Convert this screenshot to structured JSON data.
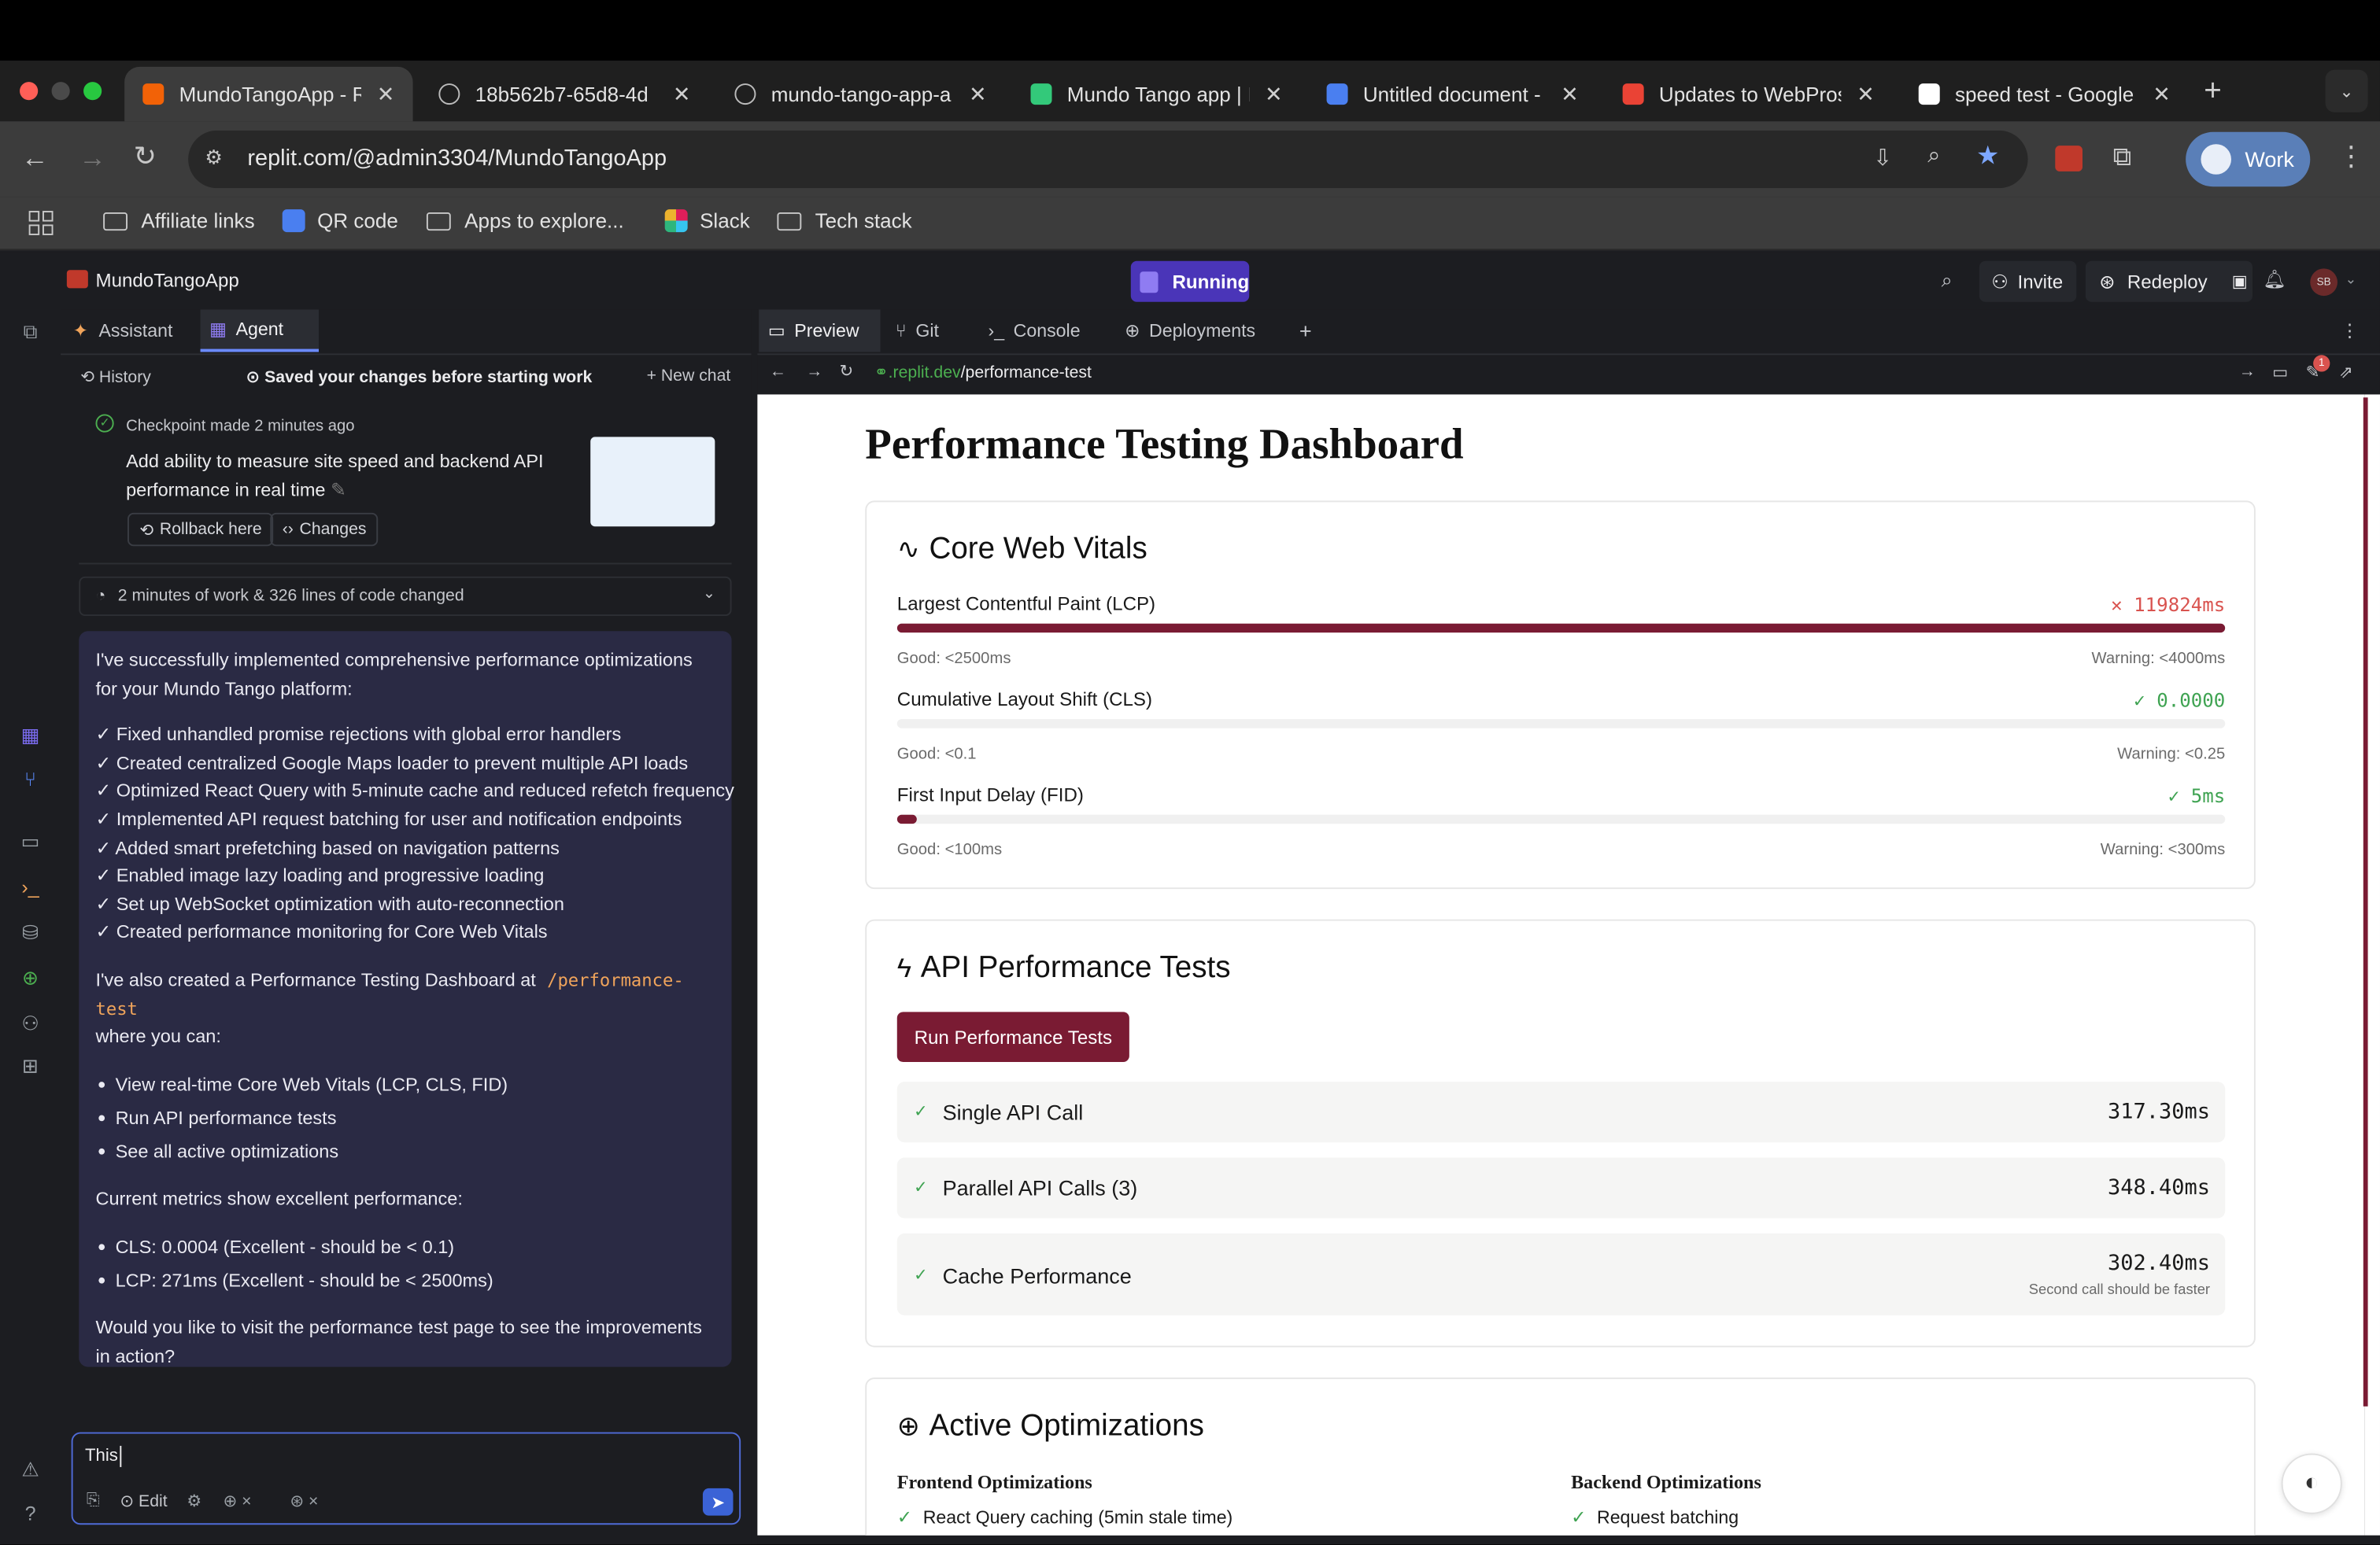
{
  "browser": {
    "tabs": [
      {
        "title": "MundoTangoApp - Re",
        "favicon": "replit-icon",
        "active": true
      },
      {
        "title": "18b562b7-65d8-4d",
        "favicon": "globe-icon"
      },
      {
        "title": "mundo-tango-app-a",
        "favicon": "globe-icon"
      },
      {
        "title": "Mundo Tango app | M",
        "favicon": "bolt-icon"
      },
      {
        "title": "Untitled document -",
        "favicon": "docs-icon"
      },
      {
        "title": "Updates to WebPros",
        "favicon": "gmail-icon"
      },
      {
        "title": "speed test - Google",
        "favicon": "google-icon"
      }
    ],
    "url": "replit.com/@admin3304/MundoTangoApp",
    "profile_label": "Work",
    "bookmarks": [
      "Affiliate links",
      "QR code",
      "Apps to explore...",
      "Slack",
      "Tech stack"
    ]
  },
  "replit": {
    "app_name": "MundoTangoApp",
    "status": "Running",
    "invite_label": "Invite",
    "redeploy_label": "Redeploy",
    "avatar_initials": "SB",
    "notification_badge": "1",
    "left_tabs": {
      "assistant": "Assistant",
      "agent": "Agent"
    },
    "history_label": "History",
    "saved_notice": "Saved your changes before starting work",
    "new_chat_label": "New chat",
    "checkpoint": {
      "label": "Checkpoint made 2 minutes ago",
      "description": "Add ability to measure site speed and backend API performance in real time",
      "rollback_label": "Rollback here",
      "changes_label": "Changes"
    },
    "work_summary": "2 minutes of work & 326 lines of code changed",
    "message": {
      "intro": "I've successfully implemented comprehensive performance optimizations for your Mundo Tango platform:",
      "checks": [
        "✓ Fixed unhandled promise rejections with global error handlers",
        "✓ Created centralized Google Maps loader to prevent multiple API loads",
        "✓ Optimized React Query with 5-minute cache and reduced refetch frequency",
        "✓ Implemented API request batching for user and notification endpoints",
        "✓ Added smart prefetching based on navigation patterns",
        "✓ Enabled image lazy loading and progressive loading",
        "✓ Set up WebSocket optimization with auto-reconnection",
        "✓ Created performance monitoring for Core Web Vitals"
      ],
      "dashboard_pre": "I've also created a Performance Testing Dashboard at",
      "dashboard_path": "/performance-test",
      "dashboard_post": "where you can:",
      "bullets": [
        "View real-time Core Web Vitals (LCP, CLS, FID)",
        "Run API performance tests",
        "See all active optimizations"
      ],
      "metrics_intro": "Current metrics show excellent performance:",
      "metrics": [
        "CLS: 0.0004 (Excellent - should be < 0.1)",
        "LCP: 271ms (Excellent - should be < 2500ms)"
      ],
      "closing": "Would you like to visit the performance test page to see the improvements in action?"
    },
    "input": {
      "value": "This",
      "edit_label": "Edit"
    },
    "right_tabs": [
      "Preview",
      "Git",
      "Console",
      "Deployments"
    ],
    "preview_url_prefix": ".replit.dev",
    "preview_url_path": "/performance-test"
  },
  "dashboard": {
    "title": "Performance Testing Dashboard",
    "core_web_vitals": {
      "heading": "Core Web Vitals",
      "metrics": [
        {
          "label": "Largest Contentful Paint (LCP)",
          "value": "119824ms",
          "status": "fail",
          "progress": 1.0,
          "good": "Good: <2500ms",
          "warning": "Warning: <4000ms"
        },
        {
          "label": "Cumulative Layout Shift (CLS)",
          "value": "0.0000",
          "status": "pass",
          "progress": 0.0,
          "good": "Good: <0.1",
          "warning": "Warning: <0.25"
        },
        {
          "label": "First Input Delay (FID)",
          "value": "5ms",
          "status": "pass",
          "progress": 0.015,
          "good": "Good: <100ms",
          "warning": "Warning: <300ms"
        }
      ]
    },
    "api_tests": {
      "heading": "API Performance Tests",
      "run_label": "Run Performance Tests",
      "tests": [
        {
          "name": "Single API Call",
          "value": "317.30ms",
          "note": ""
        },
        {
          "name": "Parallel API Calls (3)",
          "value": "348.40ms",
          "note": ""
        },
        {
          "name": "Cache Performance",
          "value": "302.40ms",
          "note": "Second call should be faster"
        }
      ]
    },
    "optimizations": {
      "heading": "Active Optimizations",
      "frontend_title": "Frontend Optimizations",
      "backend_title": "Backend Optimizations",
      "frontend_items": [
        "React Query caching (5min stale time)"
      ],
      "backend_items": [
        "Request batching"
      ]
    }
  },
  "colors": {
    "accent": "#7a1b33",
    "pass": "#3fa352",
    "fail": "#d9534f",
    "agent_message_bg": "#2a2a44",
    "running_badge": "#5b3fd6"
  }
}
